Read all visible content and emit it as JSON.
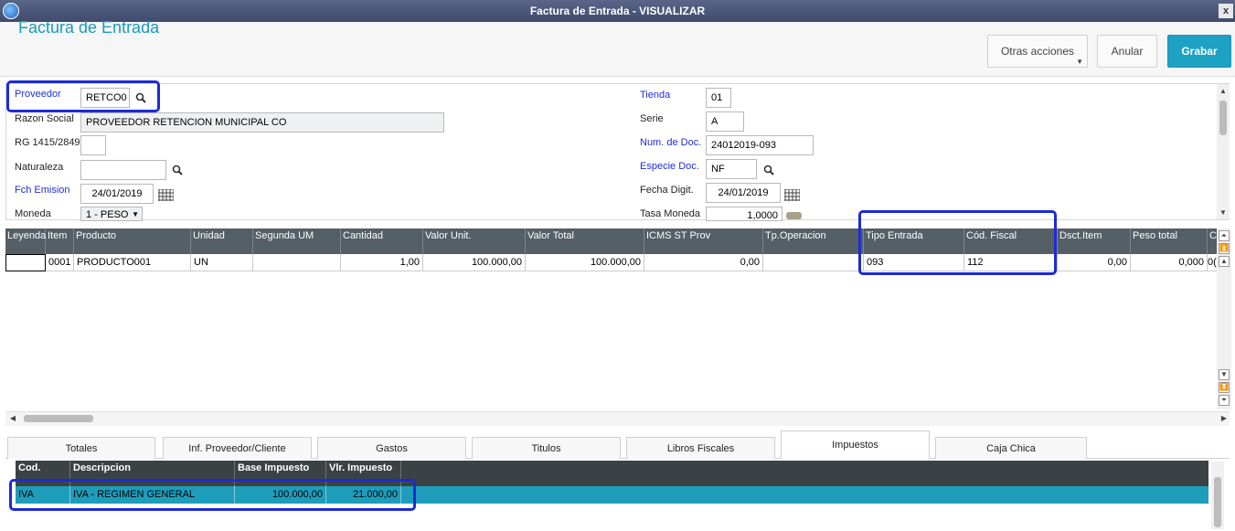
{
  "window": {
    "title": "Factura de Entrada - VISUALIZAR",
    "close": "x"
  },
  "header": {
    "title": "Factura de Entrada",
    "other_actions": "Otras acciones",
    "cancel": "Anular",
    "save": "Grabar"
  },
  "form": {
    "proveedor": {
      "label": "Proveedor",
      "value": "RETCO0"
    },
    "razon_social": {
      "label": "Razon Social",
      "value": "PROVEEDOR RETENCION MUNICIPAL CO"
    },
    "rg": {
      "label": "RG 1415/2849",
      "value": ""
    },
    "naturaleza": {
      "label": "Naturaleza",
      "value": ""
    },
    "fch_emision": {
      "label": "Fch Emision",
      "value": "24/01/2019"
    },
    "moneda": {
      "label": "Moneda",
      "value": "1 - PESO"
    },
    "tienda": {
      "label": "Tienda",
      "value": "01"
    },
    "serie": {
      "label": "Serie",
      "value": "A"
    },
    "num_doc": {
      "label": "Num. de Doc.",
      "value": "24012019-093"
    },
    "especie_doc": {
      "label": "Especie Doc.",
      "value": "NF"
    },
    "fecha_digit": {
      "label": "Fecha Digit.",
      "value": "24/01/2019"
    },
    "tasa_moneda": {
      "label": "Tasa Moneda",
      "value": "1,0000"
    }
  },
  "items_grid": {
    "headers": [
      "Leyenda",
      "Item",
      "Producto",
      "Unidad",
      "Segunda UM",
      "Cantidad",
      "Valor Unit.",
      "Valor Total",
      "ICMS ST Prov",
      "Tp.Operacion",
      "Tipo Entrada",
      "Cód. Fiscal",
      "Dsct.Item",
      "Peso total",
      "C"
    ],
    "row": [
      "",
      "0001",
      "PRODUCTO001",
      "UN",
      "",
      "1,00",
      "100.000,00",
      "100.000,00",
      "0,00",
      "",
      "093",
      "112",
      "0,00",
      "0,000",
      "0("
    ]
  },
  "tabs": [
    "Totales",
    "Inf. Proveedor/Cliente",
    "Gastos",
    "Titulos",
    "Libros Fiscales",
    "Impuestos",
    "Caja Chica"
  ],
  "tax_grid": {
    "headers": [
      "Cod.",
      "Descripcion",
      "Base Impuesto",
      "Vlr. Impuesto"
    ],
    "row": [
      "IVA",
      "IVA - REGIMEN GENERAL",
      "100.000,00",
      "21.000,00"
    ]
  },
  "colors": {
    "accent": "#1ea2c4",
    "grid_header": "#545f66",
    "selected_row": "#1e9dbb",
    "highlight": "#1c2bd6"
  }
}
